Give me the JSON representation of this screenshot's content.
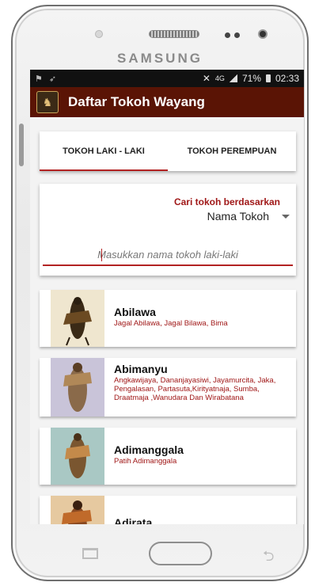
{
  "device": {
    "brand": "SAMSUNG"
  },
  "status_bar": {
    "battery": "71%",
    "time": "02:33",
    "network": "4G"
  },
  "app": {
    "title": "Daftar Tokoh Wayang",
    "icon": "wayang-app-icon"
  },
  "tabs": [
    {
      "label": "TOKOH LAKI - LAKI",
      "active": true
    },
    {
      "label": "TOKOH PEREMPUAN",
      "active": false
    }
  ],
  "search": {
    "label": "Cari tokoh berdasarkan",
    "filter_value": "Nama Tokoh",
    "placeholder": "Masukkan nama tokoh laki-laki",
    "value": ""
  },
  "characters": [
    {
      "name": "Abilawa",
      "aliases": "Jagal Abilawa, Jagal Bilawa, Bima"
    },
    {
      "name": "Abimanyu",
      "aliases": "Angkawijaya, Dananjayasiwi, Jayamurcita, Jaka, Pengalasan, Partasuta,Kirityatnaja, Sumba, Draatmaja ,Wanudara Dan Wirabatana"
    },
    {
      "name": "Adimanggala",
      "aliases": "Patih Adimanggala"
    },
    {
      "name": "Adirata",
      "aliases": ""
    }
  ],
  "colors": {
    "appbar": "#5a1405",
    "accent": "#b22222",
    "alias_text": "#a01818"
  }
}
